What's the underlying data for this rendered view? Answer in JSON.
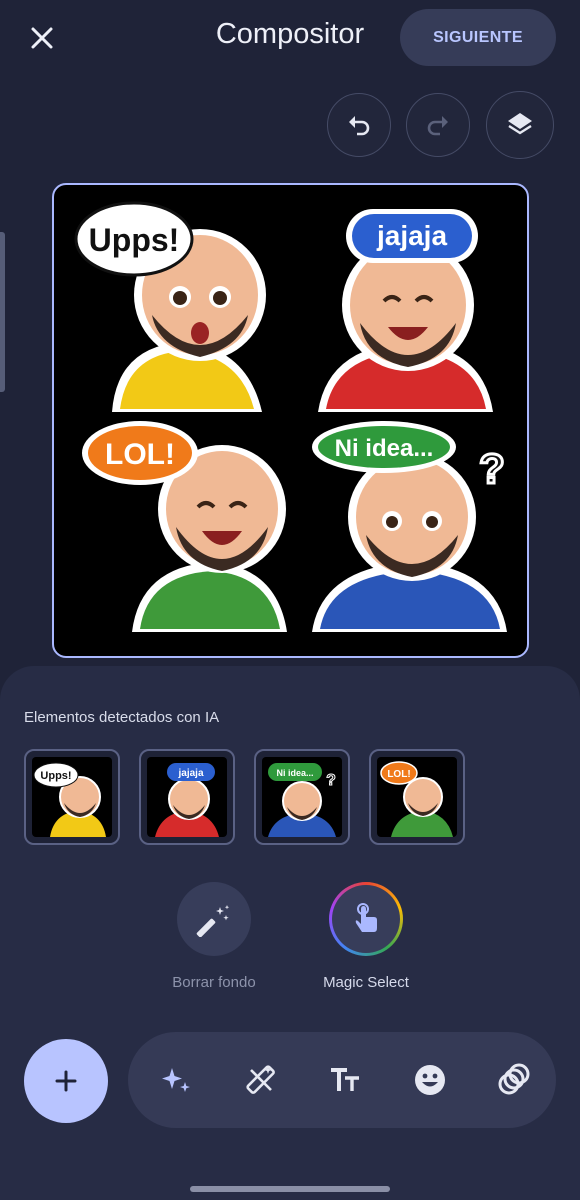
{
  "header": {
    "title": "Compositor",
    "next_label": "SIGUIENTE"
  },
  "canvas": {
    "stickers": [
      {
        "bubble": "Upps!",
        "bubble_color": "#ffffff",
        "text_color": "#111111",
        "shirt_color": "#f2c916",
        "expression": "surprised"
      },
      {
        "bubble": "jajaja",
        "bubble_color": "#2b5fcf",
        "text_color": "#ffffff",
        "shirt_color": "#d62b2b",
        "expression": "laughing"
      },
      {
        "bubble": "LOL!",
        "bubble_color": "#f07a1a",
        "text_color": "#ffffff",
        "shirt_color": "#3f9a3a",
        "expression": "laughing"
      },
      {
        "bubble": "Ni idea...",
        "bubble_color": "#2f9a3c",
        "text_color": "#ffffff",
        "shirt_color": "#2a56b8",
        "expression": "confused"
      }
    ]
  },
  "detected": {
    "label": "Elementos detectados con IA",
    "items": [
      {
        "bubble": "Upps!",
        "bubble_color": "#ffffff",
        "text_color": "#111111",
        "shirt_color": "#f2c916"
      },
      {
        "bubble": "jajaja",
        "bubble_color": "#2b5fcf",
        "text_color": "#ffffff",
        "shirt_color": "#d62b2b"
      },
      {
        "bubble": "Ni idea...",
        "bubble_color": "#2f9a3c",
        "text_color": "#ffffff",
        "shirt_color": "#2a56b8"
      },
      {
        "bubble": "LOL!",
        "bubble_color": "#f07a1a",
        "text_color": "#ffffff",
        "shirt_color": "#3f9a3a"
      }
    ]
  },
  "tools": {
    "remove_bg_label": "Borrar fondo",
    "magic_select_label": "Magic Select"
  },
  "toolbar": {
    "icons": [
      "sparkle-icon",
      "magic-tool-icon",
      "text-size-icon",
      "emoji-icon",
      "sticker-rings-icon"
    ]
  },
  "colors": {
    "background": "#1f2338",
    "accent": "#b8c4ff",
    "selection_border": "#aab8ff"
  }
}
